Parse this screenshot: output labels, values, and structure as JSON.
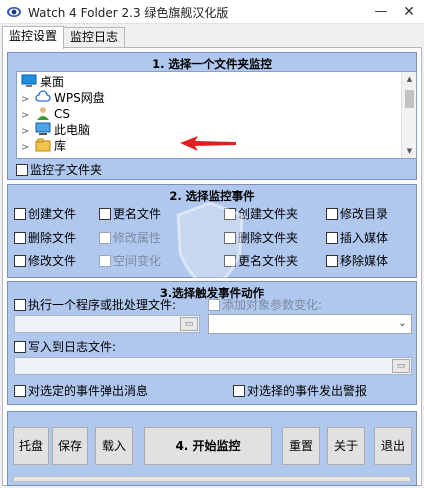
{
  "window": {
    "title": "Watch 4 Folder 2.3 绿色旗舰汉化版",
    "minimize_icon": "minimize-icon",
    "close_icon": "close-icon"
  },
  "tabs": [
    {
      "label": "监控设置",
      "active": true
    },
    {
      "label": "监控日志",
      "active": false
    }
  ],
  "section1": {
    "title": "1. 选择一个文件夹监控",
    "tree": [
      {
        "label": "桌面",
        "icon": "desktop-icon",
        "expandable": false
      },
      {
        "label": "WPS网盘",
        "icon": "cloud-icon",
        "expandable": true
      },
      {
        "label": "CS",
        "icon": "user-icon",
        "expandable": true
      },
      {
        "label": "此电脑",
        "icon": "computer-icon",
        "expandable": true
      },
      {
        "label": "库",
        "icon": "library-icon",
        "expandable": true
      }
    ],
    "subfolders_label": "监控子文件夹"
  },
  "section2": {
    "title": "2. 选择监控事件",
    "events": [
      [
        "创建文件",
        "更名文件",
        "创建文件夹",
        "修改目录"
      ],
      [
        "删除文件",
        "修改属性",
        "删除文件夹",
        "插入媒体"
      ],
      [
        "修改文件",
        "空间变化",
        "更名文件夹",
        "移除媒体"
      ]
    ]
  },
  "section3": {
    "title": "3.选择触发事件动作",
    "run_program_label": "执行一个程序或批处理文件:",
    "add_params_label": "添加对象参数变化:",
    "write_log_label": "写入到日志文件:",
    "popup_label": "对选定的事件弹出消息",
    "alarm_label": "对选择的事件发出警报"
  },
  "buttons": {
    "tray": "托盘",
    "save": "保存",
    "load": "载入",
    "start": "4. 开始监控",
    "reset": "重置",
    "about": "关于",
    "exit": "退出"
  },
  "colors": {
    "panel": "#b0c8ee",
    "panel_border": "#7e8fb5",
    "pointer_arrow": "#e02020"
  }
}
